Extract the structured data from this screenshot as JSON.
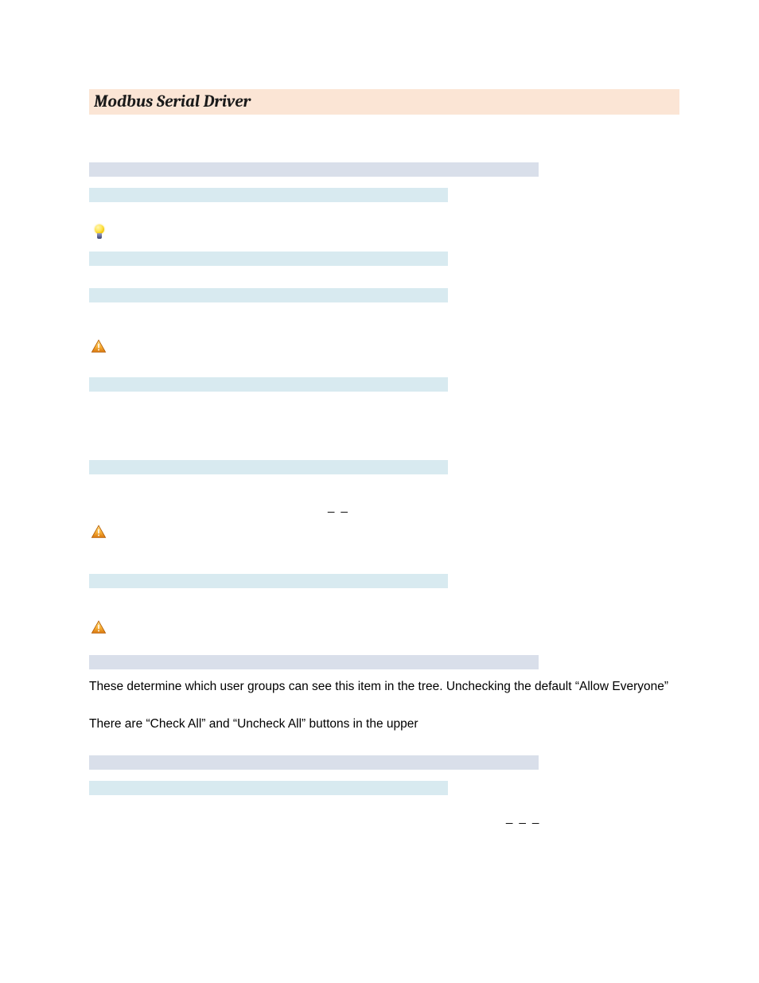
{
  "title": "Modbus Serial Driver",
  "paragraphs": {
    "permissions_intro": "These determine which user groups can see this item in the tree.  Unchecking the default “Allow Everyone”",
    "check_all_note": "There are “Check All” and “Uncheck All” buttons in the upper"
  },
  "marks": {
    "underscores_a": "_    _",
    "underscores_b": "_    _    _"
  }
}
